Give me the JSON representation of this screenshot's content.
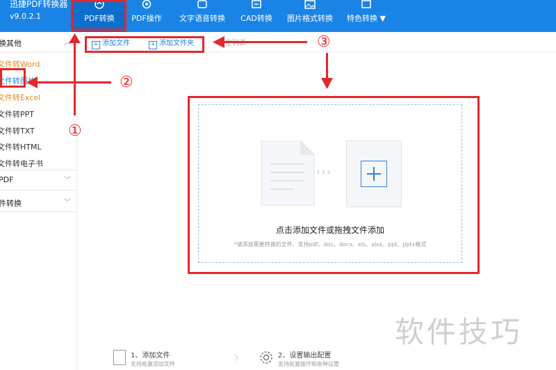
{
  "app": {
    "title": "迅捷PDF转换器",
    "version": "v9.0.2.1"
  },
  "tabs": [
    {
      "label": "PDF转换",
      "icon": "refresh-icon"
    },
    {
      "label": "PDF操作",
      "icon": "settings-icon"
    },
    {
      "label": "文字语音转换",
      "icon": "speech-icon"
    },
    {
      "label": "CAD转换",
      "icon": "cad-icon"
    },
    {
      "label": "图片格式转换",
      "icon": "image-icon"
    },
    {
      "label": "特色转换",
      "icon": "star-icon"
    }
  ],
  "sidebar": {
    "section1": "换其他",
    "items": [
      "文件转Word",
      "文件转图片",
      "文件转Excel",
      "文件转PPT",
      "文件转TXT",
      "文件转HTML",
      "文件转电子书"
    ],
    "section2": "PDF",
    "section3": "件转换"
  },
  "toolbar": {
    "add_file": "添加文件",
    "add_folder": "添加文件夹",
    "clear_list": "清空列表"
  },
  "dropzone": {
    "title": "点击添加文件或拖拽文件添加",
    "hint": "*请添加需要转换的文件，支持pdf、doc、docx、xls、xlsx、ppt、pptx格式"
  },
  "annotations": {
    "n1": "①",
    "n2": "②",
    "n3": "③"
  },
  "steps": [
    {
      "title": "1、添加文件",
      "subtitle": "支持批量添加文件"
    },
    {
      "title": "2、设置输出配置",
      "subtitle": "支持批量操作和各种设置"
    }
  ],
  "watermark": "软件技巧",
  "colors": {
    "primary": "#1a84e6",
    "annotation": "#e3272a",
    "orange": "#e38a22"
  }
}
